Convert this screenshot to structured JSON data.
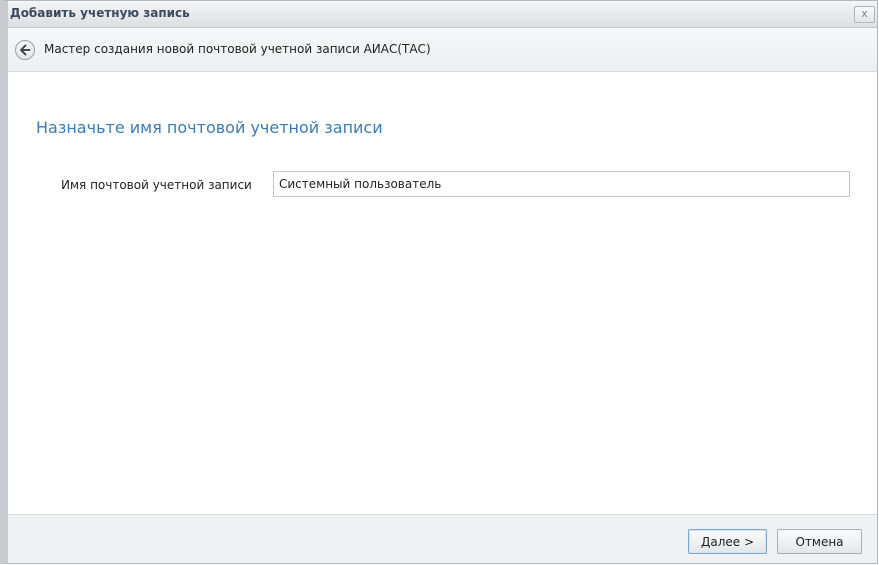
{
  "window": {
    "title": "Добавить учетную запись",
    "close_label": "x"
  },
  "wizard": {
    "title": "Мастер создания новой почтовой учетной записи АИАС(ТАС)"
  },
  "content": {
    "heading": "Назначьте имя почтовой учетной записи",
    "field": {
      "label": "Имя почтовой учетной записи",
      "value": "Системный пользователь"
    }
  },
  "footer": {
    "next_accel": "Д",
    "next_rest": "алее >",
    "cancel_label": "Отмена"
  },
  "colors": {
    "heading": "#3a7cb8",
    "titlebar": "#dcdfe3",
    "footer": "#f0f1f2"
  },
  "icons": {
    "back": "arrow-left-icon",
    "close": "close-icon"
  }
}
